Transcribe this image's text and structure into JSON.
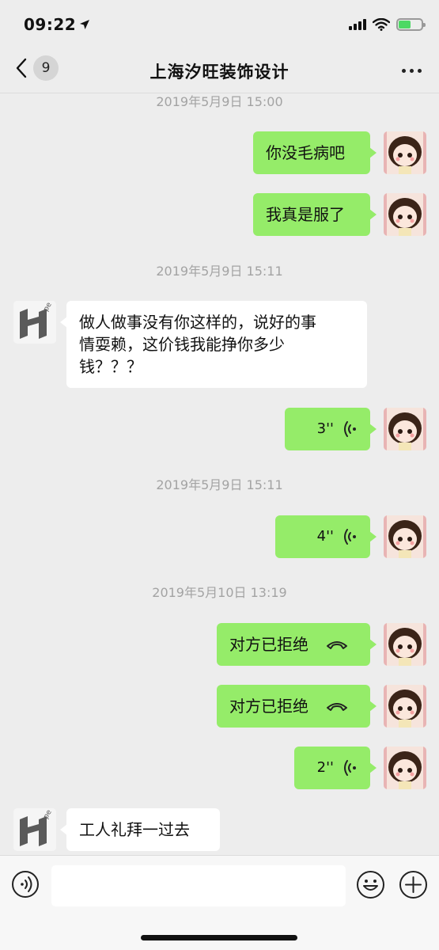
{
  "status_bar": {
    "time": "09:22",
    "icons": [
      "location-arrow-icon",
      "cellular-signal-icon",
      "wifi-icon",
      "battery-charging-icon"
    ]
  },
  "nav": {
    "back_icon": "chevron-left-icon",
    "unread_count": "9",
    "title": "上海汐旺装饰设计",
    "more_icon": "more-dots-icon"
  },
  "messages": [
    {
      "kind": "timestamp",
      "text": "2019年5月9日 15:00"
    },
    {
      "kind": "text",
      "sender": "self",
      "text": "你没毛病吧"
    },
    {
      "kind": "text",
      "sender": "self",
      "text": "我真是服了"
    },
    {
      "kind": "timestamp",
      "text": "2019年5月9日 15:11"
    },
    {
      "kind": "text",
      "sender": "other",
      "lines": [
        "做人做事没有你这样的，说好的事",
        "情耍赖，这价钱我能挣你多少",
        "钱？？？"
      ]
    },
    {
      "kind": "voice",
      "sender": "self",
      "duration": "3''",
      "icon": "voice-wave-icon"
    },
    {
      "kind": "timestamp",
      "text": "2019年5月9日 15:11"
    },
    {
      "kind": "voice",
      "sender": "self",
      "duration": "4''",
      "icon": "voice-wave-icon"
    },
    {
      "kind": "timestamp",
      "text": "2019年5月10日 13:19"
    },
    {
      "kind": "call",
      "sender": "self",
      "text": "对方已拒绝",
      "icon": "hang-up-phone-icon"
    },
    {
      "kind": "call",
      "sender": "self",
      "text": "对方已拒绝",
      "icon": "hang-up-phone-icon"
    },
    {
      "kind": "voice",
      "sender": "self",
      "duration": "2''",
      "icon": "voice-wave-icon"
    },
    {
      "kind": "text",
      "sender": "other",
      "text": "工人礼拜一过去"
    }
  ],
  "avatars": {
    "self": "cartoon-girl-avatar",
    "other_logo_text": "Hope"
  },
  "input_bar": {
    "placeholder": "",
    "icons": [
      "voice-input-icon",
      "emoji-icon",
      "plus-icon"
    ]
  },
  "colors": {
    "background": "#ededed",
    "self_bubble": "#95ec69",
    "other_bubble": "#ffffff",
    "timestamp_text": "#a3a3a3"
  }
}
